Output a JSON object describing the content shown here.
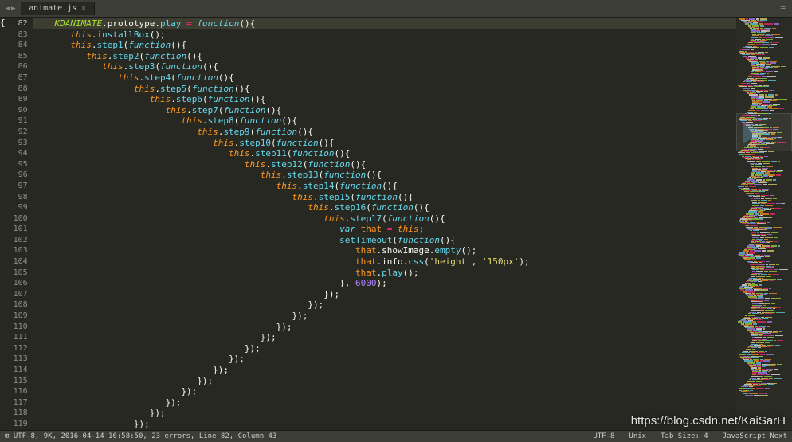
{
  "titlebar": {
    "back_icon": "◄",
    "fwd_icon": "►",
    "tab_name": "animate.js",
    "tab_close": "×",
    "menu_icon": "≡"
  },
  "lines": [
    {
      "n": 82,
      "indent": 1,
      "tokens": [
        [
          "type",
          "KDANIMATE"
        ],
        [
          "punc",
          "."
        ],
        [
          "prop",
          "prototype"
        ],
        [
          "punc",
          "."
        ],
        [
          "name",
          "play"
        ],
        [
          "punc",
          " "
        ],
        [
          "assign",
          "="
        ],
        [
          "punc",
          " "
        ],
        [
          "kw",
          "function"
        ],
        [
          "punc",
          "(){"
        ]
      ],
      "active": true,
      "highlight": true
    },
    {
      "n": 83,
      "indent": 2,
      "tokens": [
        [
          "this",
          "this"
        ],
        [
          "punc",
          "."
        ],
        [
          "call",
          "installBox"
        ],
        [
          "punc",
          "();"
        ]
      ]
    },
    {
      "n": 84,
      "indent": 2,
      "tokens": [
        [
          "this",
          "this"
        ],
        [
          "punc",
          "."
        ],
        [
          "call",
          "step1"
        ],
        [
          "punc",
          "("
        ],
        [
          "kw",
          "function"
        ],
        [
          "punc",
          "(){"
        ]
      ]
    },
    {
      "n": 85,
      "indent": 3,
      "tokens": [
        [
          "this",
          "this"
        ],
        [
          "punc",
          "."
        ],
        [
          "call",
          "step2"
        ],
        [
          "punc",
          "("
        ],
        [
          "kw",
          "function"
        ],
        [
          "punc",
          "(){"
        ]
      ]
    },
    {
      "n": 86,
      "indent": 4,
      "tokens": [
        [
          "this",
          "this"
        ],
        [
          "punc",
          "."
        ],
        [
          "call",
          "step3"
        ],
        [
          "punc",
          "("
        ],
        [
          "kw",
          "function"
        ],
        [
          "punc",
          "(){"
        ]
      ]
    },
    {
      "n": 87,
      "indent": 5,
      "tokens": [
        [
          "this",
          "this"
        ],
        [
          "punc",
          "."
        ],
        [
          "call",
          "step4"
        ],
        [
          "punc",
          "("
        ],
        [
          "kw",
          "function"
        ],
        [
          "punc",
          "(){"
        ]
      ]
    },
    {
      "n": 88,
      "indent": 6,
      "tokens": [
        [
          "this",
          "this"
        ],
        [
          "punc",
          "."
        ],
        [
          "call",
          "step5"
        ],
        [
          "punc",
          "("
        ],
        [
          "kw",
          "function"
        ],
        [
          "punc",
          "(){"
        ]
      ]
    },
    {
      "n": 89,
      "indent": 7,
      "tokens": [
        [
          "this",
          "this"
        ],
        [
          "punc",
          "."
        ],
        [
          "call",
          "step6"
        ],
        [
          "punc",
          "("
        ],
        [
          "kw",
          "function"
        ],
        [
          "punc",
          "(){"
        ]
      ]
    },
    {
      "n": 90,
      "indent": 8,
      "tokens": [
        [
          "this",
          "this"
        ],
        [
          "punc",
          "."
        ],
        [
          "call",
          "step7"
        ],
        [
          "punc",
          "("
        ],
        [
          "kw",
          "function"
        ],
        [
          "punc",
          "(){"
        ]
      ]
    },
    {
      "n": 91,
      "indent": 9,
      "tokens": [
        [
          "this",
          "this"
        ],
        [
          "punc",
          "."
        ],
        [
          "call",
          "step8"
        ],
        [
          "punc",
          "("
        ],
        [
          "kw",
          "function"
        ],
        [
          "punc",
          "(){"
        ]
      ]
    },
    {
      "n": 92,
      "indent": 10,
      "tokens": [
        [
          "this",
          "this"
        ],
        [
          "punc",
          "."
        ],
        [
          "call",
          "step9"
        ],
        [
          "punc",
          "("
        ],
        [
          "kw",
          "function"
        ],
        [
          "punc",
          "(){"
        ]
      ]
    },
    {
      "n": 93,
      "indent": 11,
      "tokens": [
        [
          "this",
          "this"
        ],
        [
          "punc",
          "."
        ],
        [
          "call",
          "step10"
        ],
        [
          "punc",
          "("
        ],
        [
          "kw",
          "function"
        ],
        [
          "punc",
          "(){"
        ]
      ]
    },
    {
      "n": 94,
      "indent": 12,
      "tokens": [
        [
          "this",
          "this"
        ],
        [
          "punc",
          "."
        ],
        [
          "call",
          "step11"
        ],
        [
          "punc",
          "("
        ],
        [
          "kw",
          "function"
        ],
        [
          "punc",
          "(){"
        ]
      ]
    },
    {
      "n": 95,
      "indent": 13,
      "tokens": [
        [
          "this",
          "this"
        ],
        [
          "punc",
          "."
        ],
        [
          "call",
          "step12"
        ],
        [
          "punc",
          "("
        ],
        [
          "kw",
          "function"
        ],
        [
          "punc",
          "(){"
        ]
      ]
    },
    {
      "n": 96,
      "indent": 14,
      "tokens": [
        [
          "this",
          "this"
        ],
        [
          "punc",
          "."
        ],
        [
          "call",
          "step13"
        ],
        [
          "punc",
          "("
        ],
        [
          "kw",
          "function"
        ],
        [
          "punc",
          "(){"
        ]
      ]
    },
    {
      "n": 97,
      "indent": 15,
      "tokens": [
        [
          "this",
          "this"
        ],
        [
          "punc",
          "."
        ],
        [
          "call",
          "step14"
        ],
        [
          "punc",
          "("
        ],
        [
          "kw",
          "function"
        ],
        [
          "punc",
          "(){"
        ]
      ]
    },
    {
      "n": 98,
      "indent": 16,
      "tokens": [
        [
          "this",
          "this"
        ],
        [
          "punc",
          "."
        ],
        [
          "call",
          "step15"
        ],
        [
          "punc",
          "("
        ],
        [
          "kw",
          "function"
        ],
        [
          "punc",
          "(){"
        ]
      ]
    },
    {
      "n": 99,
      "indent": 17,
      "tokens": [
        [
          "this",
          "this"
        ],
        [
          "punc",
          "."
        ],
        [
          "call",
          "step16"
        ],
        [
          "punc",
          "("
        ],
        [
          "kw",
          "function"
        ],
        [
          "punc",
          "(){"
        ]
      ]
    },
    {
      "n": 100,
      "indent": 18,
      "tokens": [
        [
          "this",
          "this"
        ],
        [
          "punc",
          "."
        ],
        [
          "call",
          "step17"
        ],
        [
          "punc",
          "("
        ],
        [
          "kw",
          "function"
        ],
        [
          "punc",
          "(){"
        ]
      ]
    },
    {
      "n": 101,
      "indent": 19,
      "tokens": [
        [
          "kw",
          "var"
        ],
        [
          "punc",
          " "
        ],
        [
          "var",
          "that"
        ],
        [
          "punc",
          " "
        ],
        [
          "assign",
          "="
        ],
        [
          "punc",
          " "
        ],
        [
          "this",
          "this"
        ],
        [
          "punc",
          ";"
        ]
      ]
    },
    {
      "n": 102,
      "indent": 19,
      "tokens": [
        [
          "call",
          "setTimeout"
        ],
        [
          "punc",
          "("
        ],
        [
          "kw",
          "function"
        ],
        [
          "punc",
          "(){"
        ]
      ]
    },
    {
      "n": 103,
      "indent": 20,
      "tokens": [
        [
          "var",
          "that"
        ],
        [
          "punc",
          "."
        ],
        [
          "prop",
          "showImage"
        ],
        [
          "punc",
          "."
        ],
        [
          "call",
          "empty"
        ],
        [
          "punc",
          "();"
        ]
      ]
    },
    {
      "n": 104,
      "indent": 20,
      "tokens": [
        [
          "var",
          "that"
        ],
        [
          "punc",
          "."
        ],
        [
          "prop",
          "info"
        ],
        [
          "punc",
          "."
        ],
        [
          "call",
          "css"
        ],
        [
          "punc",
          "("
        ],
        [
          "str",
          "'height'"
        ],
        [
          "punc",
          ", "
        ],
        [
          "str",
          "'150px'"
        ],
        [
          "punc",
          ");"
        ]
      ]
    },
    {
      "n": 105,
      "indent": 20,
      "tokens": [
        [
          "var",
          "that"
        ],
        [
          "punc",
          "."
        ],
        [
          "call",
          "play"
        ],
        [
          "punc",
          "();"
        ]
      ]
    },
    {
      "n": 106,
      "indent": 19,
      "tokens": [
        [
          "punc",
          "}, "
        ],
        [
          "num",
          "6000"
        ],
        [
          "punc",
          ");"
        ]
      ]
    },
    {
      "n": 107,
      "indent": 18,
      "tokens": [
        [
          "punc",
          "});"
        ]
      ]
    },
    {
      "n": 108,
      "indent": 17,
      "tokens": [
        [
          "punc",
          "});"
        ]
      ]
    },
    {
      "n": 109,
      "indent": 16,
      "tokens": [
        [
          "punc",
          "});"
        ]
      ]
    },
    {
      "n": 110,
      "indent": 15,
      "tokens": [
        [
          "punc",
          "});"
        ]
      ]
    },
    {
      "n": 111,
      "indent": 14,
      "tokens": [
        [
          "punc",
          "});"
        ]
      ]
    },
    {
      "n": 112,
      "indent": 13,
      "tokens": [
        [
          "punc",
          "});"
        ]
      ]
    },
    {
      "n": 113,
      "indent": 12,
      "tokens": [
        [
          "punc",
          "});"
        ]
      ]
    },
    {
      "n": 114,
      "indent": 11,
      "tokens": [
        [
          "punc",
          "});"
        ]
      ]
    },
    {
      "n": 115,
      "indent": 10,
      "tokens": [
        [
          "punc",
          "});"
        ]
      ]
    },
    {
      "n": 116,
      "indent": 9,
      "tokens": [
        [
          "punc",
          "});"
        ]
      ]
    },
    {
      "n": 117,
      "indent": 8,
      "tokens": [
        [
          "punc",
          "});"
        ]
      ]
    },
    {
      "n": 118,
      "indent": 7,
      "tokens": [
        [
          "punc",
          "});"
        ]
      ]
    },
    {
      "n": 119,
      "indent": 6,
      "tokens": [
        [
          "punc",
          "});"
        ]
      ]
    }
  ],
  "status": {
    "left": "⊞  UTF-8, 9K, 2016-04-14 16:58:50, 23 errors, Line 82, Column 43",
    "encoding": "UTF-8",
    "line_ending": "Unix",
    "tab": "Tab Size: 4",
    "syntax": "JavaScript Next"
  },
  "watermark": "https://blog.csdn.net/KaiSarH"
}
